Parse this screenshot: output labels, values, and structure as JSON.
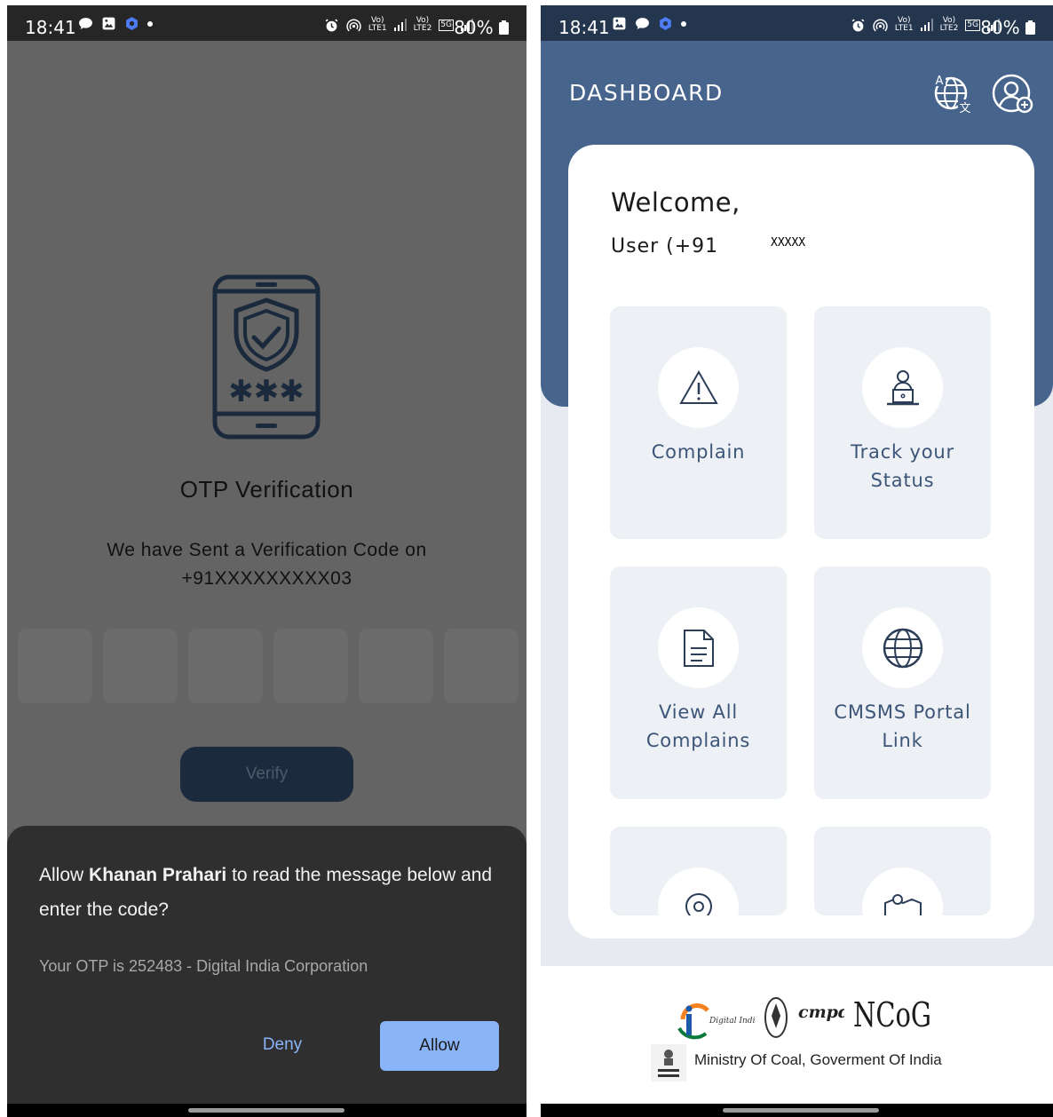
{
  "status_bar": {
    "time": "18:41",
    "battery": "80%",
    "net1": "Vo)\nLTE1",
    "net2": "Vo)\nLTE2",
    "net5g": "5G"
  },
  "otp_screen": {
    "title": "OTP Verification",
    "sent_line1": "We have Sent a Verification Code on",
    "sent_line2": "+91XXXXXXXXX03",
    "box_count": 6,
    "verify_label": "Verify",
    "dialog": {
      "prefix": "Allow ",
      "app_name": "Khanan Prahari",
      "suffix": " to read the message below and enter the code?",
      "otp_message": "Your OTP is 252483 - Digital India Corporation",
      "deny_label": "Deny",
      "allow_label": "Allow"
    }
  },
  "dashboard": {
    "title": "DASHBOARD",
    "welcome": "Welcome,",
    "user_label": "User  (+91",
    "user_masked": "XXXXX",
    "tiles": [
      {
        "label_line1": "Complain",
        "label_line2": "",
        "icon": "warning-icon"
      },
      {
        "label_line1": "Track your",
        "label_line2": "Status",
        "icon": "user-laptop-icon"
      },
      {
        "label_line1": "View All",
        "label_line2": "Complains",
        "icon": "document-icon"
      },
      {
        "label_line1": "CMSMS Portal",
        "label_line2": "Link",
        "icon": "globe-icon"
      }
    ],
    "footer": {
      "ministry": "Ministry Of Coal, Goverment Of India",
      "logo_texts": [
        "Digital India",
        "cmpdi",
        "NCoG"
      ]
    }
  },
  "colors": {
    "header_blue": "#46648c",
    "status_blue": "#24364e",
    "tile_bg": "#edf0f5",
    "tile_text": "#3c5578",
    "allow_blue": "#8ab4f8"
  }
}
